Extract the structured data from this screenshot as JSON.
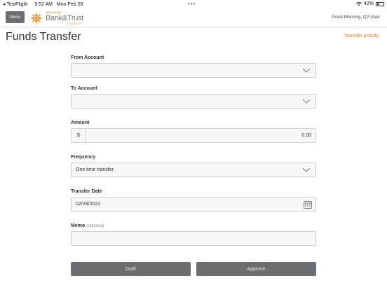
{
  "status_bar": {
    "app": "TestFlight",
    "time": "9:52 AM",
    "date": "Mon Feb 28",
    "battery_text": "42%",
    "battery_level": 0.42
  },
  "header": {
    "menu_label": "Menu",
    "logo_small": "ORANGE",
    "logo_name": "Bank&Trust",
    "logo_company": "COMPANY",
    "greeting": "Good Morning, Q2 User"
  },
  "page": {
    "title": "Funds Transfer",
    "activity_link": "Transfer activity"
  },
  "form": {
    "from_account": {
      "label": "From Account",
      "value": ""
    },
    "to_account": {
      "label": "To Account",
      "value": ""
    },
    "amount": {
      "label": "Amount",
      "prefix": "$",
      "value": "0.00"
    },
    "frequency": {
      "label": "Frequency",
      "value": "One time transfer"
    },
    "transfer_date": {
      "label": "Transfer Date",
      "value": "02/28/2022"
    },
    "memo": {
      "label": "Memo",
      "optional": "(optional)",
      "value": ""
    }
  },
  "actions": {
    "draft_label": "Draft",
    "approve_label": "Approve"
  },
  "colors": {
    "accent": "#e27b25",
    "button": "#6b6e70"
  }
}
